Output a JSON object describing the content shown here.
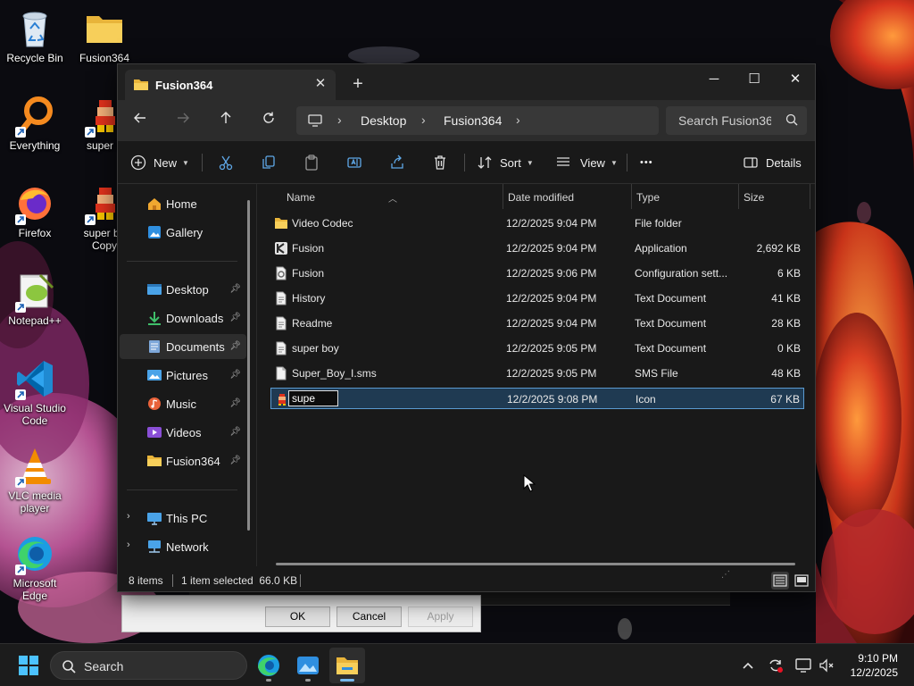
{
  "desktop": {
    "icons": [
      {
        "label": "Recycle Bin",
        "icon": "recycle-bin-icon"
      },
      {
        "label": "Fusion364",
        "icon": "folder-icon"
      },
      {
        "label": "Everything",
        "icon": "everything-search-icon"
      },
      {
        "label": "super b",
        "icon": "super-boy-icon"
      },
      {
        "label": "Firefox",
        "icon": "firefox-icon"
      },
      {
        "label": "super bo",
        "label2": "Copy",
        "icon": "super-boy-icon"
      },
      {
        "label": "Notepad++",
        "icon": "notepad-plus-plus-icon"
      },
      {
        "label": "Visual Studio",
        "label2": "Code",
        "icon": "vscode-icon"
      },
      {
        "label": "VLC media",
        "label2": "player",
        "icon": "vlc-icon"
      },
      {
        "label": "Microsoft",
        "label2": "Edge",
        "icon": "edge-icon"
      }
    ]
  },
  "background_dialog": {
    "ok": "OK",
    "cancel": "Cancel",
    "apply": "Apply"
  },
  "window": {
    "tab_title": "Fusion364",
    "close_tab": "✕",
    "new_tab": "+",
    "minimize": "─",
    "maximize": "☐",
    "close": "✕"
  },
  "address": {
    "breadcrumbs": [
      "Desktop",
      "Fusion364"
    ],
    "search_placeholder": "Search Fusion364"
  },
  "toolbar": {
    "new_label": "New",
    "sort_label": "Sort",
    "view_label": "View",
    "more_label": "•••",
    "details_label": "Details"
  },
  "sidebar": {
    "top": [
      {
        "label": "Home",
        "icon": "home-icon"
      },
      {
        "label": "Gallery",
        "icon": "gallery-icon"
      }
    ],
    "pinned": [
      {
        "label": "Desktop",
        "icon": "desktop-icon"
      },
      {
        "label": "Downloads",
        "icon": "downloads-icon"
      },
      {
        "label": "Documents",
        "icon": "documents-icon",
        "selected": true
      },
      {
        "label": "Pictures",
        "icon": "pictures-icon"
      },
      {
        "label": "Music",
        "icon": "music-icon"
      },
      {
        "label": "Videos",
        "icon": "videos-icon"
      },
      {
        "label": "Fusion364",
        "icon": "folder-icon"
      }
    ],
    "bottom": [
      {
        "label": "This PC",
        "icon": "this-pc-icon"
      },
      {
        "label": "Network",
        "icon": "network-icon"
      }
    ]
  },
  "columns": {
    "name": "Name",
    "date": "Date modified",
    "type": "Type",
    "size": "Size"
  },
  "files": [
    {
      "name": "Video Codec",
      "date": "12/2/2025 9:04 PM",
      "type": "File folder",
      "size": "",
      "icon": "folder-icon"
    },
    {
      "name": "Fusion",
      "date": "12/2/2025 9:04 PM",
      "type": "Application",
      "size": "2,692 KB",
      "icon": "application-icon"
    },
    {
      "name": "Fusion",
      "date": "12/2/2025 9:06 PM",
      "type": "Configuration sett...",
      "size": "6 KB",
      "icon": "config-file-icon"
    },
    {
      "name": "History",
      "date": "12/2/2025 9:04 PM",
      "type": "Text Document",
      "size": "41 KB",
      "icon": "text-file-icon"
    },
    {
      "name": "Readme",
      "date": "12/2/2025 9:04 PM",
      "type": "Text Document",
      "size": "28 KB",
      "icon": "text-file-icon"
    },
    {
      "name": "super boy",
      "date": "12/2/2025 9:05 PM",
      "type": "Text Document",
      "size": "0 KB",
      "icon": "text-file-icon"
    },
    {
      "name": "Super_Boy_I.sms",
      "date": "12/2/2025 9:05 PM",
      "type": "SMS File",
      "size": "48 KB",
      "icon": "generic-file-icon"
    },
    {
      "name": "supe",
      "date": "12/2/2025 9:08 PM",
      "type": "Icon",
      "size": "67 KB",
      "icon": "image-icon",
      "renaming": true
    }
  ],
  "status": {
    "items": "8 items",
    "selected": "1 item selected  66.0 KB"
  },
  "taskbar": {
    "search_label": "Search",
    "time": "9:10 PM",
    "date": "12/2/2025"
  },
  "colors": {
    "accent": "#76b9ed",
    "selection": "#1f3a52",
    "window_bg": "#191919"
  }
}
